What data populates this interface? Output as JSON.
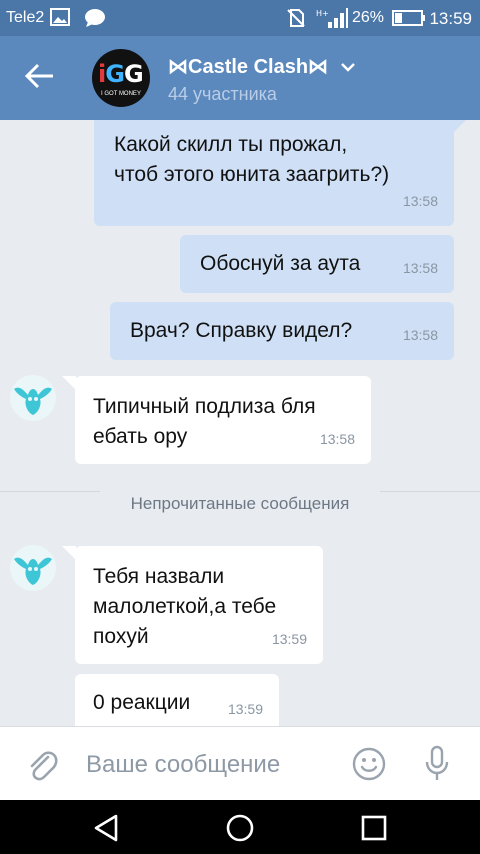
{
  "status_bar": {
    "carrier": "Tele2",
    "battery_percent": "26%",
    "time": "13:59",
    "icons": [
      "image-icon",
      "chat-bubble-icon",
      "no-sim-icon",
      "signal-icon",
      "battery-icon"
    ]
  },
  "header": {
    "title": "⋈Castle Clash⋈",
    "subtitle": "44 участника",
    "avatar_text": "iGG",
    "avatar_tagline": "I GOT MONEY"
  },
  "messages": [
    {
      "direction": "out",
      "text": "Какой скилл ты прожал,\nчтоб этого юнита заагрить?)",
      "time": "13:58"
    },
    {
      "direction": "out",
      "text": "Обоснуй за аута",
      "time": "13:58"
    },
    {
      "direction": "out",
      "text": "Врач? Справку видел?",
      "time": "13:58"
    },
    {
      "direction": "in",
      "text": "Типичный подлиза бля\nебать ору",
      "time": "13:58"
    },
    {
      "direction": "in",
      "text": "Тебя назвали\nмалолеткой,а тебе\nпохуй",
      "time": "13:59"
    },
    {
      "direction": "in",
      "text": "0 реакции",
      "time": "13:59"
    }
  ],
  "unread_divider": "Непрочитанные сообщения",
  "composer": {
    "placeholder": "Ваше сообщение"
  },
  "colors": {
    "header": "#5b88bd",
    "status_bar": "#4a76a8",
    "outgoing_bubble": "#cfe0f6",
    "incoming_bubble": "#ffffff",
    "chat_background": "#e8ebf0",
    "accent_icon": "#3ec6d6"
  }
}
